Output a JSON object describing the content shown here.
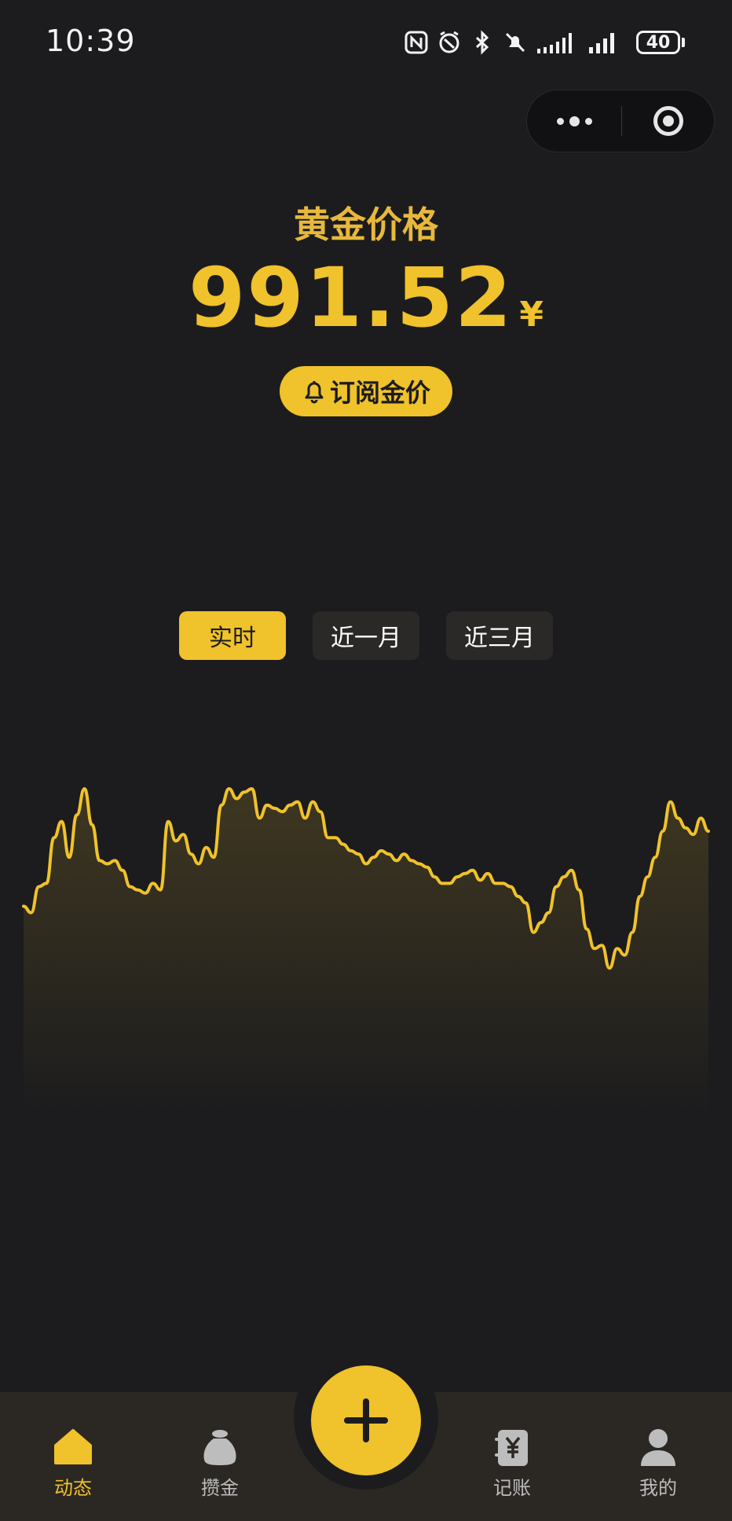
{
  "status_bar": {
    "time": "10:39",
    "battery": "40",
    "icons": [
      "nfc-icon",
      "alarm-icon",
      "bluetooth-icon",
      "mute-icon",
      "signal-icon",
      "signal-icon",
      "battery-icon"
    ]
  },
  "capsule": {
    "more_icon": "more-dots-icon",
    "close_icon": "target-circle-icon"
  },
  "header": {
    "title": "黄金价格",
    "price": "991.52",
    "currency": "¥",
    "subscribe_label": "订阅金价",
    "subscribe_icon": "bell-icon"
  },
  "tabs": [
    {
      "label": "实时",
      "active": true
    },
    {
      "label": "近一月",
      "active": false
    },
    {
      "label": "近三月",
      "active": false
    }
  ],
  "colors": {
    "accent": "#f0c22b",
    "background": "#1c1c1e",
    "tabbar": "#2b2823",
    "inactive_tab": "#2a2927"
  },
  "chart_data": {
    "type": "area",
    "title": "",
    "xlabel": "",
    "ylabel": "",
    "grid": false,
    "legend": "none",
    "ylim": [
      0,
      100
    ],
    "series": [
      {
        "values": [
          57,
          55,
          63,
          64,
          78,
          83,
          72,
          85,
          93,
          82,
          71,
          70,
          71,
          68,
          63,
          62,
          61,
          64,
          62,
          83,
          77,
          79,
          73,
          70,
          75,
          72,
          88,
          93,
          90,
          92,
          93,
          84,
          88,
          87,
          86,
          88,
          89,
          84,
          89,
          86,
          78,
          78,
          76,
          74,
          73,
          70,
          72,
          74,
          73,
          71,
          73,
          71,
          70,
          69,
          66,
          64,
          64,
          66,
          67,
          68,
          65,
          67,
          64,
          64,
          63,
          60,
          58,
          49,
          52,
          55,
          63,
          66,
          68,
          62,
          50,
          44,
          45,
          38,
          44,
          42,
          49,
          60,
          66,
          72,
          80,
          89,
          84,
          81,
          79,
          84,
          80
        ]
      }
    ]
  },
  "nav": {
    "fab_icon": "plus-icon",
    "items": [
      {
        "label": "动态",
        "icon": "home-icon",
        "active": true
      },
      {
        "label": "攒金",
        "icon": "money-bag-icon",
        "active": false
      },
      {
        "label": "记账",
        "icon": "ledger-icon",
        "active": false
      },
      {
        "label": "我的",
        "icon": "user-icon",
        "active": false
      }
    ]
  }
}
